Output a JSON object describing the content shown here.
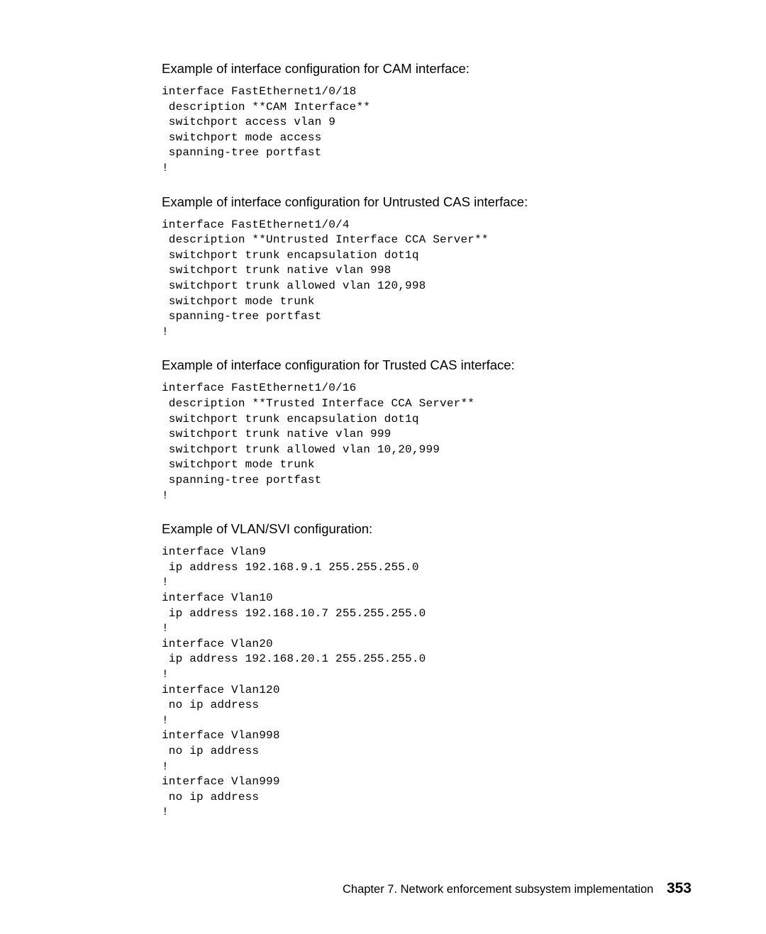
{
  "sections": [
    {
      "heading": "Example of interface configuration for CAM interface:",
      "code": "interface FastEthernet1/0/18\n description **CAM Interface**\n switchport access vlan 9\n switchport mode access\n spanning-tree portfast\n!"
    },
    {
      "heading": "Example of interface configuration for Untrusted CAS interface:",
      "code": "interface FastEthernet1/0/4\n description **Untrusted Interface CCA Server**\n switchport trunk encapsulation dot1q\n switchport trunk native vlan 998\n switchport trunk allowed vlan 120,998\n switchport mode trunk\n spanning-tree portfast\n!"
    },
    {
      "heading": "Example of interface configuration for Trusted CAS interface:",
      "code": "interface FastEthernet1/0/16\n description **Trusted Interface CCA Server**\n switchport trunk encapsulation dot1q\n switchport trunk native vlan 999\n switchport trunk allowed vlan 10,20,999\n switchport mode trunk\n spanning-tree portfast\n!"
    },
    {
      "heading": "Example of VLAN/SVI configuration:",
      "code": "interface Vlan9\n ip address 192.168.9.1 255.255.255.0\n!\ninterface Vlan10\n ip address 192.168.10.7 255.255.255.0\n!\ninterface Vlan20\n ip address 192.168.20.1 255.255.255.0\n!\ninterface Vlan120\n no ip address\n!\ninterface Vlan998\n no ip address\n!\ninterface Vlan999\n no ip address\n!"
    }
  ],
  "footer": {
    "chapter": "Chapter 7. Network enforcement subsystem implementation",
    "page": "353"
  }
}
